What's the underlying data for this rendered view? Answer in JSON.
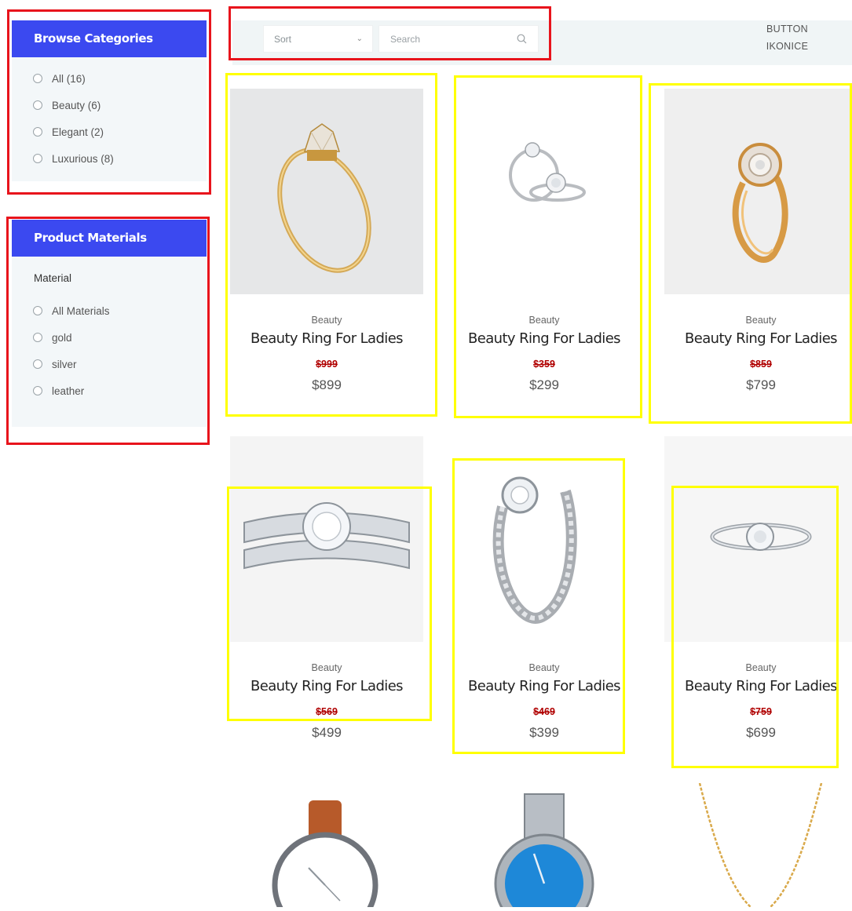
{
  "sidebar": {
    "categories": {
      "title": "Browse Categories",
      "items": [
        {
          "label": "All (16)"
        },
        {
          "label": "Beauty (6)"
        },
        {
          "label": "Elegant (2)"
        },
        {
          "label": "Luxurious (8)"
        }
      ]
    },
    "materials": {
      "title": "Product Materials",
      "subtitle": "Material",
      "items": [
        {
          "label": "All Materials"
        },
        {
          "label": "gold"
        },
        {
          "label": "silver"
        },
        {
          "label": "leather"
        }
      ]
    }
  },
  "toolbar": {
    "sort_label": "Sort",
    "search_placeholder": "Search",
    "button_line1": "BUTTON",
    "button_line2": "IKONICE"
  },
  "products": [
    {
      "category": "Beauty",
      "name": "Beauty Ring For Ladies",
      "old_price": "$999",
      "price": "$899",
      "image": "gold-solitaire-ring"
    },
    {
      "category": "Beauty",
      "name": "Beauty Ring For Ladies",
      "old_price": "$359",
      "price": "$299",
      "image": "silver-halo-ring-pair"
    },
    {
      "category": "Beauty",
      "name": "Beauty Ring For Ladies",
      "old_price": "$859",
      "price": "$799",
      "image": "gold-halo-twist-ring"
    },
    {
      "category": "Beauty",
      "name": "Beauty Ring For Ladies",
      "old_price": "$569",
      "price": "$499",
      "image": "silver-diamond-band-set"
    },
    {
      "category": "Beauty",
      "name": "Beauty Ring For Ladies",
      "old_price": "$469",
      "price": "$399",
      "image": "silver-braided-ring"
    },
    {
      "category": "Beauty",
      "name": "Beauty Ring For Ladies",
      "old_price": "$759",
      "price": "$699",
      "image": "silver-solitaire-ring"
    },
    {
      "image": "leather-strap-watch"
    },
    {
      "image": "blue-dial-steel-watch"
    },
    {
      "image": "gold-chain-necklace"
    }
  ],
  "colors": {
    "accent": "#3b49f0",
    "annotation_red": "#e8141c",
    "annotation_yellow": "#ffff00",
    "strike_price": "#b00000"
  }
}
